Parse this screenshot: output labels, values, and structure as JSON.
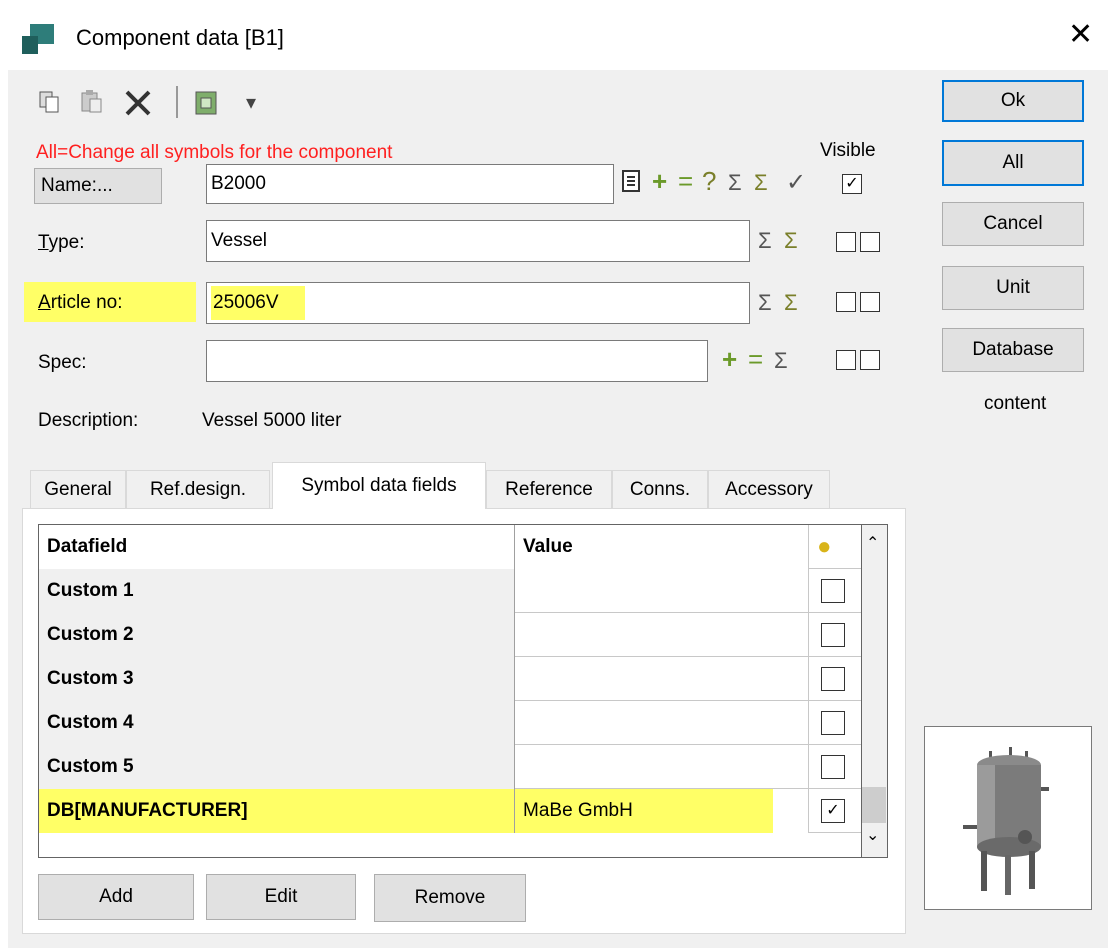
{
  "window": {
    "title": "Component data [B1]",
    "close_glyph": "✕"
  },
  "toolbar": {
    "icons": [
      "copy-icon",
      "paste-icon",
      "delete-icon",
      "database-icon",
      "dropdown-arrow-icon"
    ],
    "dropdown_glyph": "▾"
  },
  "hint": "All=Change all symbols for the component",
  "visible_label": "Visible",
  "side_buttons": {
    "ok": "Ok",
    "all": "All",
    "cancel": "Cancel",
    "unit": "Unit",
    "database": "Database"
  },
  "side_text": "content",
  "fields": {
    "name": {
      "label": "Name:...",
      "value": "B2000",
      "visible_checked": true
    },
    "type": {
      "label_u": "T",
      "label_rest": "ype:",
      "value": "Vessel"
    },
    "article": {
      "label_u": "A",
      "label_rest": "rticle no:",
      "value": "25006V"
    },
    "spec": {
      "label": "Spec:",
      "value": ""
    },
    "description": {
      "label": "Description:",
      "value": "Vessel 5000 liter"
    }
  },
  "tabs": [
    "General",
    "Ref.design.",
    "Symbol data fields",
    "Reference",
    "Conns.",
    "Accessory"
  ],
  "active_tab": "Symbol data fields",
  "grid": {
    "headers": [
      "Datafield",
      "Value"
    ],
    "rows": [
      {
        "field": "Custom 1",
        "value": "",
        "checked": false
      },
      {
        "field": "Custom 2",
        "value": "",
        "checked": false
      },
      {
        "field": "Custom 3",
        "value": "",
        "checked": false
      },
      {
        "field": "Custom 4",
        "value": "",
        "checked": false
      },
      {
        "field": "Custom 5",
        "value": "",
        "checked": false
      },
      {
        "field": "DB[MANUFACTURER]",
        "value": "MaBe GmbH",
        "checked": true
      }
    ]
  },
  "bottom_buttons": {
    "add": "Add",
    "edit": "Edit",
    "remove": "Remove"
  },
  "colors": {
    "hint": "#ff2020",
    "highlight": "#ffff66",
    "primary_border": "#0078d7"
  }
}
